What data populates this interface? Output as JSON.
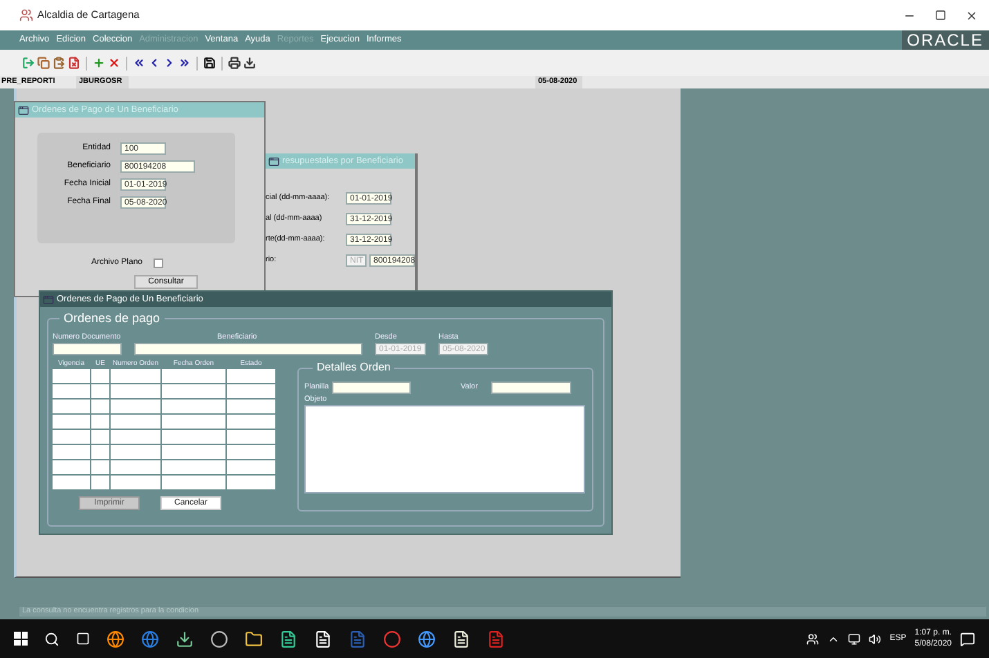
{
  "window": {
    "title": "Alcaldia de Cartagena"
  },
  "menu": [
    {
      "label": "Archivo",
      "disabled": false
    },
    {
      "label": "Edicion",
      "disabled": false
    },
    {
      "label": "Coleccion",
      "disabled": false
    },
    {
      "label": "Administracion",
      "disabled": true
    },
    {
      "label": "Ventana",
      "disabled": false
    },
    {
      "label": "Ayuda",
      "disabled": false
    },
    {
      "label": "Reportes",
      "disabled": true
    },
    {
      "label": "Ejecucion",
      "disabled": false
    },
    {
      "label": "Informes",
      "disabled": false
    }
  ],
  "logo": "ORACLE",
  "context": {
    "module": "PRE_REPORTI",
    "user": "JBURGOSR",
    "date": "05-08-2020"
  },
  "filter_window": {
    "title": "Ordenes de Pago de Un Beneficiario",
    "active": false,
    "fields": [
      {
        "label": "Entidad",
        "value": "100"
      },
      {
        "label": "Beneficiario",
        "value": "800194208"
      },
      {
        "label": "Fecha Inicial",
        "value": "01-01-2019"
      },
      {
        "label": "Fecha Final",
        "value": "05-08-2020"
      }
    ],
    "flat_file": {
      "label": "Archivo Plano",
      "checked": false
    },
    "query_button": "Consultar"
  },
  "budget_window": {
    "title": "resupuestales por Beneficiario",
    "active": false,
    "fields": [
      {
        "label": "cial (dd-mm-aaaa):",
        "values": [
          {
            "text": "01-01-2019",
            "disabled": false
          }
        ]
      },
      {
        "label": "al (dd-mm-aaaa)",
        "values": [
          {
            "text": "31-12-2019",
            "disabled": false
          }
        ]
      },
      {
        "label": "rte(dd-mm-aaaa):",
        "values": [
          {
            "text": "31-12-2019",
            "disabled": false
          }
        ]
      },
      {
        "label": "rio:",
        "values": [
          {
            "text": "NIT",
            "disabled": true
          },
          {
            "text": "800194208",
            "disabled": false
          }
        ]
      }
    ]
  },
  "orders_window": {
    "title": "Ordenes de Pago de Un Beneficiario",
    "active": true,
    "group": "Ordenes de pago",
    "header_fields": [
      {
        "label": "Numero Documento",
        "disabled": false
      },
      {
        "label": "Beneficiario",
        "disabled": false
      },
      {
        "label": "Desde",
        "value": "01-01-2019",
        "disabled": true
      },
      {
        "label": "Hasta",
        "value": "05-08-2020",
        "disabled": true
      }
    ],
    "columns": [
      "Vigencia",
      "UE",
      "Numero Orden",
      "Fecha Orden",
      "Estado"
    ],
    "details": {
      "title": "Detalles Orden",
      "fields": [
        {
          "label": "Planilla"
        },
        {
          "label": "Valor"
        }
      ],
      "text_area_label": "Objeto"
    },
    "buttons": [
      {
        "label": "Imprimir",
        "disabled": true
      },
      {
        "label": "Cancelar",
        "disabled": false
      }
    ]
  },
  "status_message": "La consulta no encuentra registros para la condicion",
  "taskbar": {
    "language": "ESP",
    "time": "1:07 p. m.",
    "date": "5/08/2020"
  }
}
